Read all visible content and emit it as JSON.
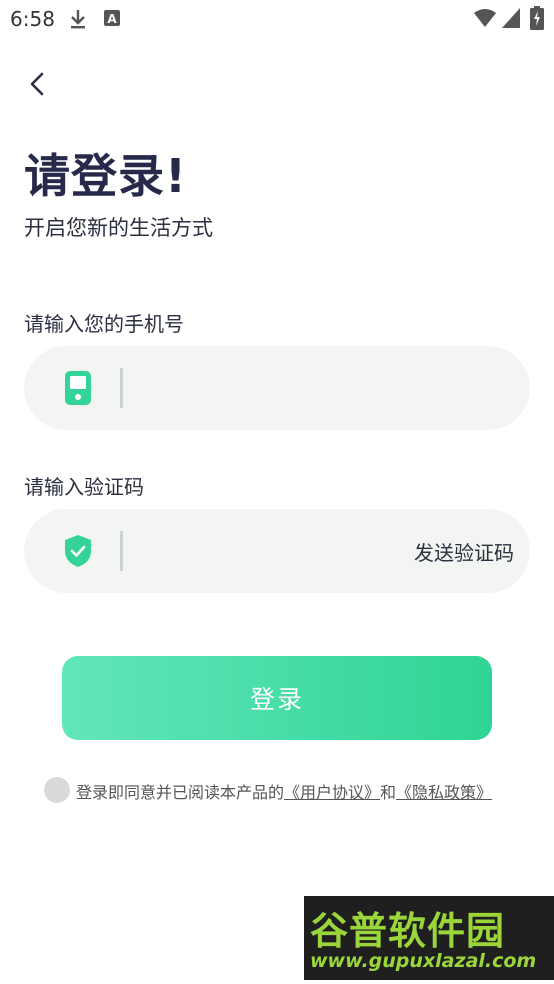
{
  "status_bar": {
    "time": "6:58",
    "icons": [
      "download-icon",
      "a-icon",
      "wifi-icon",
      "signal-icon",
      "battery-icon"
    ]
  },
  "nav": {
    "back_icon": "chevron-left-icon"
  },
  "header": {
    "title": "请登录!",
    "subtitle": "开启您新的生活方式"
  },
  "phone": {
    "label": "请输入您的手机号",
    "value": "",
    "placeholder": "",
    "icon": "phone-icon"
  },
  "code": {
    "label": "请输入验证码",
    "value": "",
    "placeholder": "",
    "icon": "shield-check-icon",
    "send_label": "发送验证码"
  },
  "login_button": {
    "label": "登录"
  },
  "agreement": {
    "prefix": "登录即同意并已阅读本产品的",
    "user_agreement": "《用户协议》",
    "conjunction": "和",
    "privacy_policy": "《隐私政策》"
  },
  "watermark": {
    "logo": "谷普软件园",
    "url": "www.gupuxlazal.com"
  },
  "colors": {
    "accent_start": "#62e6bb",
    "accent_end": "#2fd494",
    "title": "#26294a",
    "field_bg": "#f3f5f2",
    "icon_green": "#34d399"
  }
}
